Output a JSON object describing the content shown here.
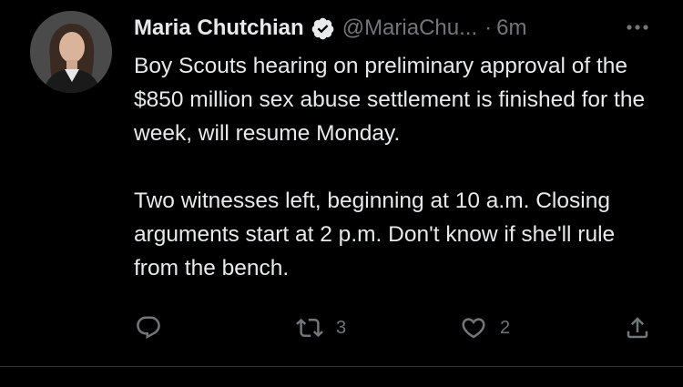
{
  "tweet": {
    "author_name": "Maria Chutchian",
    "author_handle": "@MariaChu...",
    "separator": "·",
    "time": "6m",
    "paragraphs": [
      "Boy Scouts hearing on preliminary approval of the $850 million sex abuse settlement is finished for the week, will resume Monday.",
      "Two witnesses left, beginning at 10 a.m. Closing arguments start at 2 p.m. Don't know if she'll rule from the bench."
    ],
    "retweet_count": "3",
    "like_count": "2"
  },
  "colors": {
    "background": "#000000",
    "primary_text": "#e7e9ea",
    "secondary_text": "#71767b",
    "divider": "#2f3336"
  },
  "icons": {
    "verified": "verified-badge-icon",
    "more": "more-horizontal-icon",
    "reply": "reply-icon",
    "retweet": "retweet-icon",
    "like": "heart-icon",
    "share": "share-icon"
  }
}
